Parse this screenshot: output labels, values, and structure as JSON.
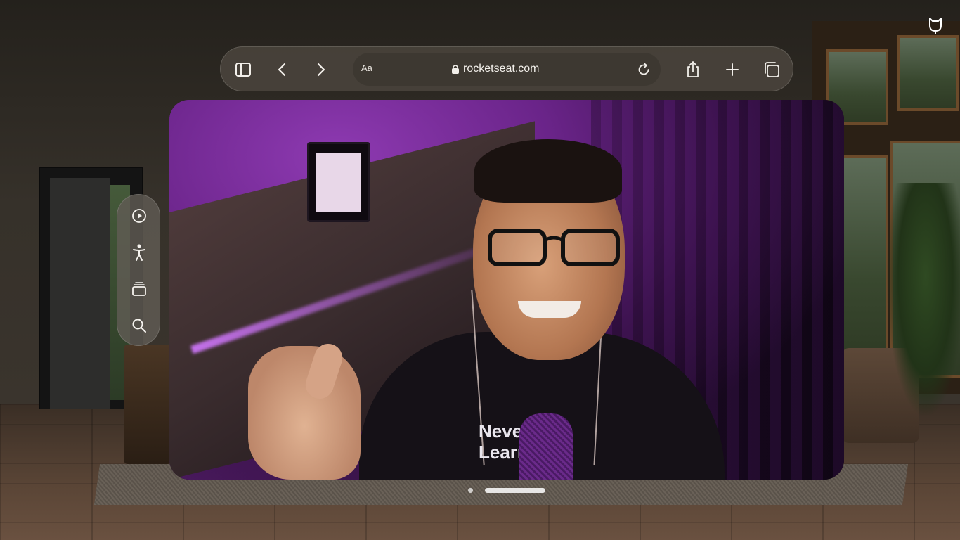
{
  "toolbar": {
    "sidebar_icon": "sidebar-icon",
    "back_icon": "chevron-left-icon",
    "forward_icon": "chevron-right-icon",
    "reader_label": "Aa",
    "url": "rocketseat.com",
    "lock_icon": "lock-icon",
    "reload_icon": "reload-icon",
    "share_icon": "share-icon",
    "new_tab_icon": "plus-icon",
    "tabs_icon": "tabs-icon"
  },
  "side_ornament": {
    "items": [
      "play-icon",
      "accessibility-icon",
      "stack-icon",
      "search-icon"
    ]
  },
  "corner_icon": "cat-icon",
  "video": {
    "shirt_text_line1": "Neve",
    "shirt_text_line2": "Learn"
  },
  "colors": {
    "accent_purple": "#8e3ab2",
    "toolbar_bg": "#4e4840",
    "icon": "#f2efea"
  },
  "pager": {
    "page_count": 2,
    "current_page": 2
  }
}
